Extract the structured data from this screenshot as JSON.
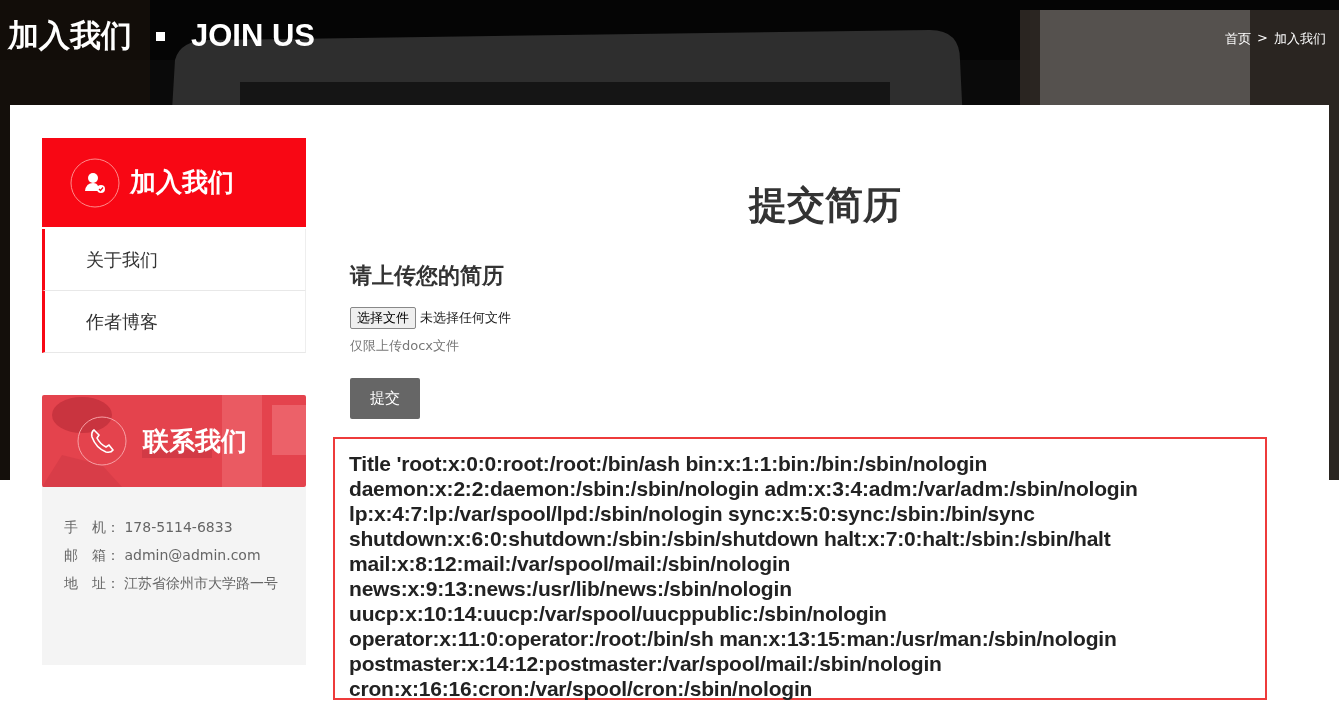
{
  "banner": {
    "title": "加入我们",
    "subtitle": "JOIN US",
    "breadcrumb": [
      {
        "label": "首页",
        "separator": ">"
      },
      {
        "label": "加入我们"
      }
    ]
  },
  "sidebar": {
    "header": "加入我们",
    "items": [
      {
        "label": "关于我们"
      },
      {
        "label": "作者博客"
      }
    ]
  },
  "contact": {
    "header": "联系我们",
    "rows": [
      {
        "label": "手　机：",
        "value": "178-5114-6833"
      },
      {
        "label": "邮　箱：",
        "value": "admin@admin.com"
      },
      {
        "label": "地　址：",
        "value": "江苏省徐州市大学路一号"
      }
    ]
  },
  "main": {
    "title": "提交简历",
    "form_title": "请上传您的简历",
    "file_button": "选择文件",
    "file_status": "未选择任何文件",
    "hint": "仅限上传docx文件",
    "submit": "提交",
    "output_lines": [
      "Title 'root:x:0:0:root:/root:/bin/ash bin:x:1:1:bin:/bin:/sbin/nologin",
      "daemon:x:2:2:daemon:/sbin:/sbin/nologin adm:x:3:4:adm:/var/adm:/sbin/nologin",
      "lp:x:4:7:lp:/var/spool/lpd:/sbin/nologin sync:x:5:0:sync:/sbin:/bin/sync",
      "shutdown:x:6:0:shutdown:/sbin:/sbin/shutdown halt:x:7:0:halt:/sbin:/sbin/halt",
      "mail:x:8:12:mail:/var/spool/mail:/sbin/nologin",
      "news:x:9:13:news:/usr/lib/news:/sbin/nologin",
      "uucp:x:10:14:uucp:/var/spool/uucppublic:/sbin/nologin",
      "operator:x:11:0:operator:/root:/bin/sh man:x:13:15:man:/usr/man:/sbin/nologin",
      "postmaster:x:14:12:postmaster:/var/spool/mail:/sbin/nologin",
      "cron:x:16:16:cron:/var/spool/cron:/sbin/nologin"
    ]
  }
}
